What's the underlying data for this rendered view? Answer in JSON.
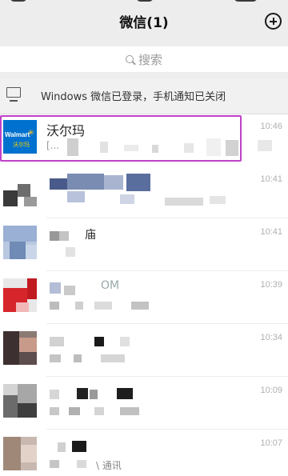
{
  "header": {
    "title": "微信(1)",
    "add_icon": "plus-circle-icon"
  },
  "search": {
    "label": "搜索"
  },
  "notice": {
    "text": "Windows 微信已登录，手机通知已关闭"
  },
  "chats": [
    {
      "name": "沃尔玛",
      "preview": "[...",
      "time": "10:46",
      "avatar_text": "Walmart",
      "avatar_sub": "沃尔玛",
      "selected": true
    },
    {
      "name": "",
      "preview": "",
      "time": "10:41"
    },
    {
      "name": "庙",
      "preview": "",
      "time": "10:41"
    },
    {
      "name": "OM",
      "preview": "",
      "time": "10:39"
    },
    {
      "name": "",
      "preview": "",
      "time": "10:34"
    },
    {
      "name": "",
      "preview": "",
      "time": "10:09"
    },
    {
      "name": "",
      "preview": "\\ 通讯",
      "time": "10:07"
    }
  ],
  "colors": {
    "header_bg": "#ededed",
    "selection_border": "#c040c8",
    "walmart_blue": "#0071ce",
    "walmart_yellow": "#ffc220"
  }
}
